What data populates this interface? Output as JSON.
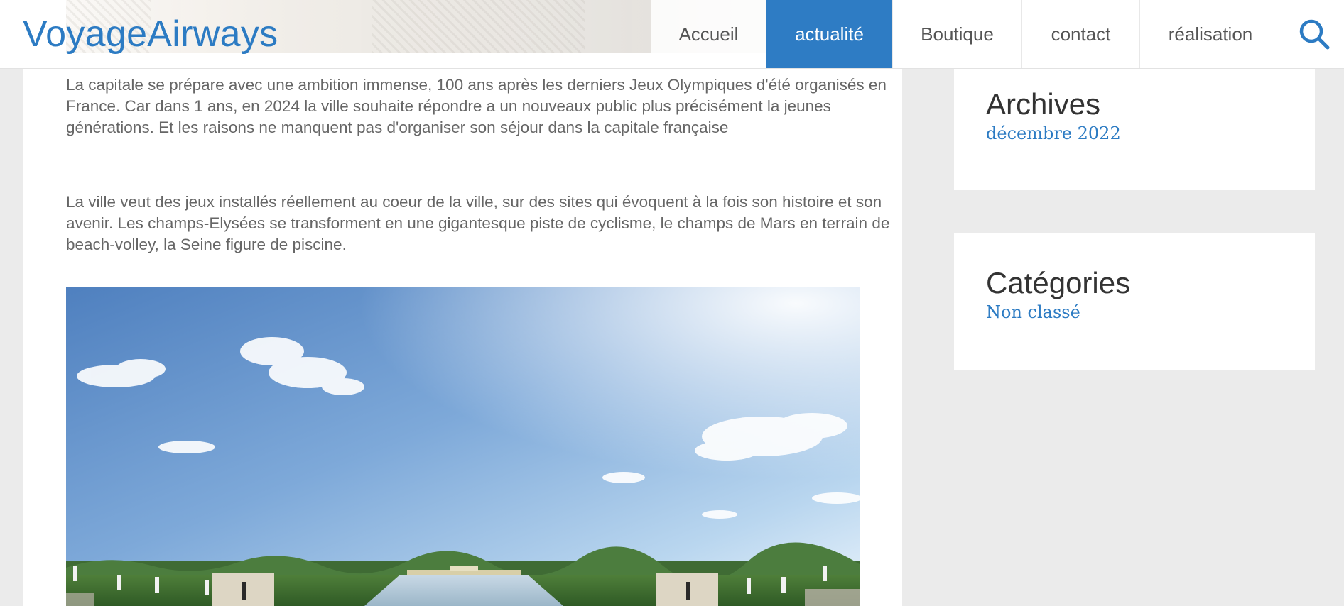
{
  "site": {
    "logo": "VoyageAirways"
  },
  "nav": {
    "items": [
      {
        "label": "Accueil"
      },
      {
        "label": "actualité"
      },
      {
        "label": "Boutique"
      },
      {
        "label": "contact"
      },
      {
        "label": "réalisation"
      }
    ],
    "active_label": "actualité",
    "search_icon": "search-icon"
  },
  "article": {
    "paragraphs": [
      "La capitale se prépare avec une ambition immense, 100 ans après les derniers Jeux Olympiques d'été organisés en France. Car dans 1 ans, en 2024 la ville souhaite répondre a un nouveaux public plus précisément la jeunes générations. Et les raisons ne manquent pas d'organiser son séjour dans la capitale française",
      "La ville veut des jeux installés réellement au coeur de la ville, sur des sites qui évoquent à la fois son histoire et son avenir. Les champs-Elysées se transforment en une gigantesque piste de cyclisme, le champs de Mars en terrain de beach-volley, la Seine figure de piscine."
    ]
  },
  "sidebar": {
    "archives": {
      "title": "Archives",
      "link": "décembre 2022"
    },
    "categories": {
      "title": "Catégories",
      "link": "Non classé"
    }
  },
  "colors": {
    "accent": "#2e7cc4",
    "link": "#2c7bc3",
    "page_bg": "#ebebeb",
    "body_text": "#666666"
  }
}
